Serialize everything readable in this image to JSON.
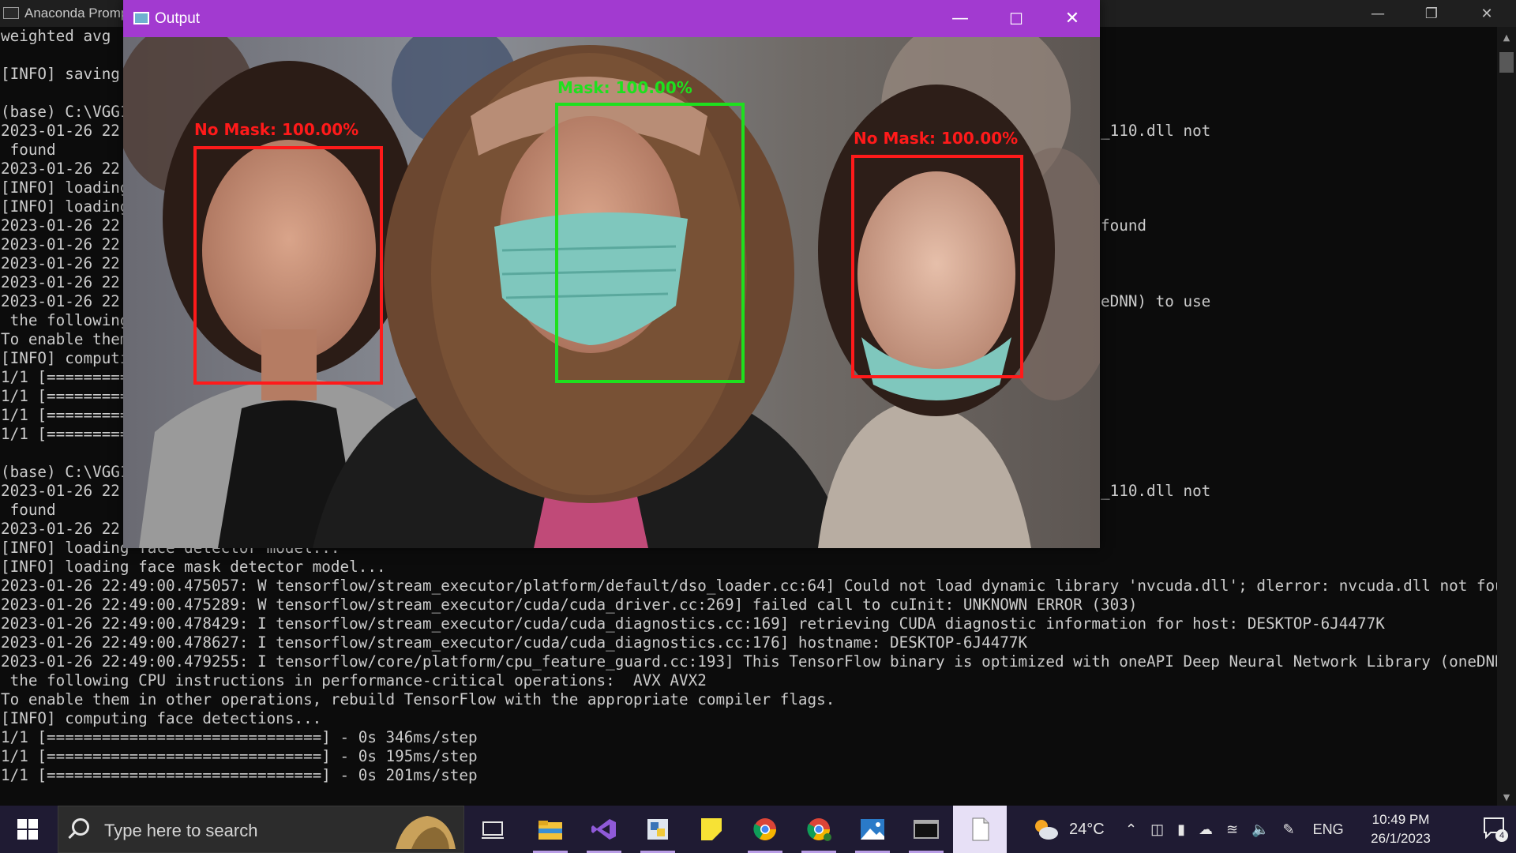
{
  "console_window": {
    "title": "Anaconda Prompt",
    "caption_icons": [
      "minimize-icon",
      "restore-icon",
      "close-icon"
    ],
    "lines": [
      "weighted avg",
      "",
      "[INFO] saving",
      "",
      "(base) C:\\VGG1",
      "2023-01-26 22:                                                                        dart64_110.dll'; dlerror: cudart64_110.dll not",
      " found",
      "2023-01-26 22:                                                                        e a GPU set up on your machine.",
      "[INFO] loading",
      "[INFO] loading",
      "2023-01-26 22:                                                                        uda.dll'; dlerror: nvcuda.dll not found",
      "2023-01-26 22:",
      "2023-01-26 22:                                                                        for host: DESKTOP-6J4477K",
      "2023-01-26 22:",
      "2023-01-26 22:                                                                        PI Deep Neural Network Library (oneDNN) to use",
      " the following",
      "To enable them",
      "[INFO] computi",
      "1/1 [=========",
      "1/1 [=========",
      "1/1 [=========",
      "1/1 [=========",
      "",
      "(base) C:\\VGG1",
      "2023-01-26 22:                                                                        dart64_110.dll'; dlerror: cudart64_110.dll not",
      " found",
      "2023-01-26 22:                                                                        e a GPU set up on your machine.",
      "[INFO] loading face detector model...",
      "[INFO] loading face mask detector model...",
      "2023-01-26 22:49:00.475057: W tensorflow/stream_executor/platform/default/dso_loader.cc:64] Could not load dynamic library 'nvcuda.dll'; dlerror: nvcuda.dll not found",
      "2023-01-26 22:49:00.475289: W tensorflow/stream_executor/cuda/cuda_driver.cc:269] failed call to cuInit: UNKNOWN ERROR (303)",
      "2023-01-26 22:49:00.478429: I tensorflow/stream_executor/cuda/cuda_diagnostics.cc:169] retrieving CUDA diagnostic information for host: DESKTOP-6J4477K",
      "2023-01-26 22:49:00.478627: I tensorflow/stream_executor/cuda/cuda_diagnostics.cc:176] hostname: DESKTOP-6J4477K",
      "2023-01-26 22:49:00.479255: I tensorflow/core/platform/cpu_feature_guard.cc:193] This TensorFlow binary is optimized with oneAPI Deep Neural Network Library (oneDNN) to use",
      " the following CPU instructions in performance-critical operations:  AVX AVX2",
      "To enable them in other operations, rebuild TensorFlow with the appropriate compiler flags.",
      "[INFO] computing face detections...",
      "1/1 [==============================] - 0s 346ms/step",
      "1/1 [==============================] - 0s 195ms/step",
      "1/1 [==============================] - 0s 201ms/step"
    ]
  },
  "output_window": {
    "title": "Output",
    "caption_icons": [
      "minimize-icon",
      "maximize-icon",
      "close-icon"
    ],
    "detections": [
      {
        "label": "No Mask: 100.00%",
        "color": "#ff1a1a"
      },
      {
        "label": "Mask: 100.00%",
        "color": "#1ee01e"
      },
      {
        "label": "No Mask: 100.00%",
        "color": "#ff1a1a"
      }
    ]
  },
  "taskbar": {
    "search_placeholder": "Type here to search",
    "apps": [
      "task-view-icon",
      "file-explorer-icon",
      "visual-studio-icon",
      "python-icon",
      "sticky-notes-icon",
      "chrome-icon",
      "chrome-profile-icon",
      "photos-icon",
      "terminal-icon",
      "notepad-icon"
    ],
    "weather_temp": "24°C",
    "language": "ENG",
    "time": "10:49 PM",
    "date": "26/1/2023",
    "notification_count": "4"
  },
  "colors": {
    "output_titlebar": "#a23ad0",
    "mask_box": "#1ee01e",
    "no_mask_box": "#ff1a1a",
    "taskbar": "#1f1b33"
  }
}
